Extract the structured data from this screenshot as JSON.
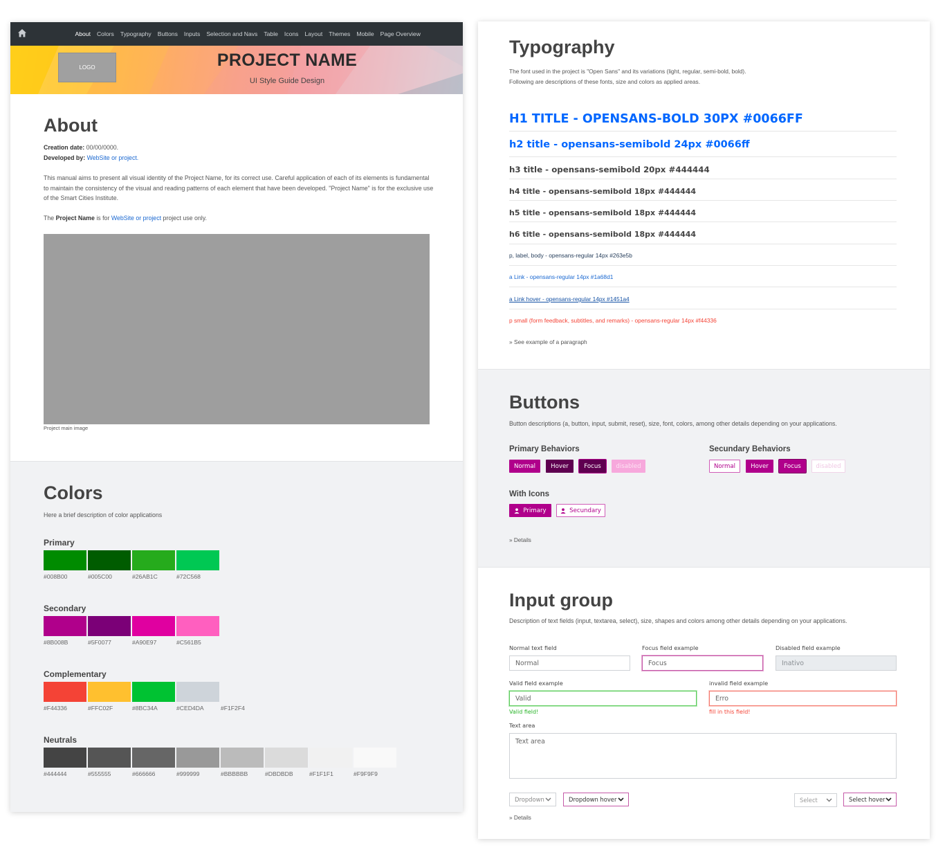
{
  "nav": {
    "items": [
      "About",
      "Colors",
      "Typography",
      "Buttons",
      "Inputs",
      "Selection and Navs",
      "Table",
      "Icons",
      "Layout",
      "Themes",
      "Mobile",
      "Page Overview"
    ]
  },
  "banner": {
    "logo": "LOGO",
    "title": "PROJECT NAME",
    "subtitle": "UI Style Guide Design"
  },
  "about": {
    "title": "About",
    "creation_label": "Creation date:",
    "creation_value": "00/00/0000.",
    "developed_label": "Developed by:",
    "developed_link": "WebSite or project.",
    "paragraph": "This manual aims to present all visual identity of the Project Name, for its correct use. Careful application of each of its elements is fundamental to maintain the consistency of the visual and reading patterns of each element that have been developed. \"Project Name\" is for the exclusive use of the Smart Cities Institute.",
    "usage_prefix": "The",
    "usage_bold": "Project Name",
    "usage_mid": "is for",
    "usage_link": "WebSite or project",
    "usage_suffix": "project use only.",
    "image_caption": "Project main image"
  },
  "colors": {
    "title": "Colors",
    "description": "Here a brief description of color applications",
    "groups": [
      {
        "name": "Primary",
        "swatches": [
          {
            "hex": "#008B00",
            "label": "#008B00"
          },
          {
            "hex": "#005C00",
            "label": "#005C00"
          },
          {
            "hex": "#26AB1C",
            "label": "#26AB1C"
          },
          {
            "hex": "#00C853",
            "label": "#72C568"
          }
        ]
      },
      {
        "name": "Secondary",
        "swatches": [
          {
            "hex": "#B0008B",
            "label": "#8B008B"
          },
          {
            "hex": "#7B0077",
            "label": "#5F0077"
          },
          {
            "hex": "#E000A0",
            "label": "#A90E97"
          },
          {
            "hex": "#FF5FBF",
            "label": "#C561B5"
          }
        ]
      },
      {
        "name": "Complementary",
        "swatches": [
          {
            "hex": "#F44336",
            "label": "#F44336"
          },
          {
            "hex": "#FFC02F",
            "label": "#FFC02F"
          },
          {
            "hex": "#00C232",
            "label": "#8BC34A"
          },
          {
            "hex": "#CED4DA",
            "label": "#CED4DA"
          },
          {
            "hex": "#F1F2F4",
            "label": "#F1F2F4"
          }
        ]
      },
      {
        "name": "Neutrals",
        "swatches": [
          {
            "hex": "#444444",
            "label": "#444444"
          },
          {
            "hex": "#555555",
            "label": "#555555"
          },
          {
            "hex": "#666666",
            "label": "#666666"
          },
          {
            "hex": "#999999",
            "label": "#999999"
          },
          {
            "hex": "#BBBBBB",
            "label": "#BBBBBB"
          },
          {
            "hex": "#DBDBDB",
            "label": "#DBDBDB"
          },
          {
            "hex": "#F1F1F1",
            "label": "#F1F1F1"
          },
          {
            "hex": "#F9F9F9",
            "label": "#F9F9F9"
          }
        ]
      }
    ]
  },
  "typography": {
    "title": "Typography",
    "desc1": "The font used in the project is \"Open Sans\" and its variations (light, regular, semi-bold, bold).",
    "desc2": "Following are descriptions of these fonts, size and colors as applied areas.",
    "rows": [
      {
        "text": "H1 TITLE - OPENSANS-BOLD 30PX #0066FF",
        "color": "#0066FF"
      },
      {
        "text": "h2 title - opensans-semibold 24px #0066ff",
        "color": "#0066FF"
      },
      {
        "text": "h3 title - opensans-semibold 20px #444444",
        "color": "#444444"
      },
      {
        "text": "h4 title - opensans-semibold 18px #444444",
        "color": "#444444"
      },
      {
        "text": "h5 title - opensans-semibold 18px #444444",
        "color": "#444444"
      },
      {
        "text": "h6 title - opensans-semibold 18px #444444",
        "color": "#444444"
      },
      {
        "text": "p, label, body - opensans-regular 14px #263e5b",
        "color": "#263E5B"
      },
      {
        "text": "a Link - opensans-regular 14px #1a68d1",
        "color": "#1A68D1"
      },
      {
        "text": "a Link hover - opensans-regular 14px #1451a4",
        "color": "#1451A4"
      },
      {
        "text": "p small (form feedback, subtitles, and remarks) - opensans-regular 14px #f44336",
        "color": "#F44336"
      }
    ],
    "example_link": "» See example of a paragraph"
  },
  "buttons": {
    "title": "Buttons",
    "description": "Button descriptions (a, button, input, submit, reset), size, font, colors, among other details depending on your applications.",
    "primary_title": "Primary Behaviors",
    "secondary_title": "Secundary Behaviors",
    "states": [
      "Normal",
      "Hover",
      "Focus",
      "disabled"
    ],
    "icons_title": "With Icons",
    "icon_primary": "Primary",
    "icon_secondary": "Secundary",
    "details": "» Details",
    "colors": {
      "primary": "#B0008B",
      "hover": "#5F0050",
      "focus": "#7B0060"
    }
  },
  "inputs": {
    "title": "Input group",
    "description": "Description of text fields (input, textarea, select), size, shapes and colors among other details depending on your applications.",
    "normal_label": "Normal text field",
    "normal_value": "Normal",
    "focus_label": "Focus field example",
    "focus_value": "Focus",
    "disabled_label": "Disabled field example",
    "disabled_value": "Inativo",
    "valid_label": "Valid field example",
    "valid_value": "Valid",
    "valid_feedback": "Valid field!",
    "invalid_label": "invalid field example",
    "invalid_value": "Erro",
    "invalid_feedback": "fill in this field!",
    "textarea_label": "Text area",
    "textarea_placeholder": "Text area",
    "dropdown": "Dropdown",
    "dropdown_hover": "Dropdown hover",
    "select": "Select",
    "select_hover": "Select hover",
    "details": "» Details"
  }
}
